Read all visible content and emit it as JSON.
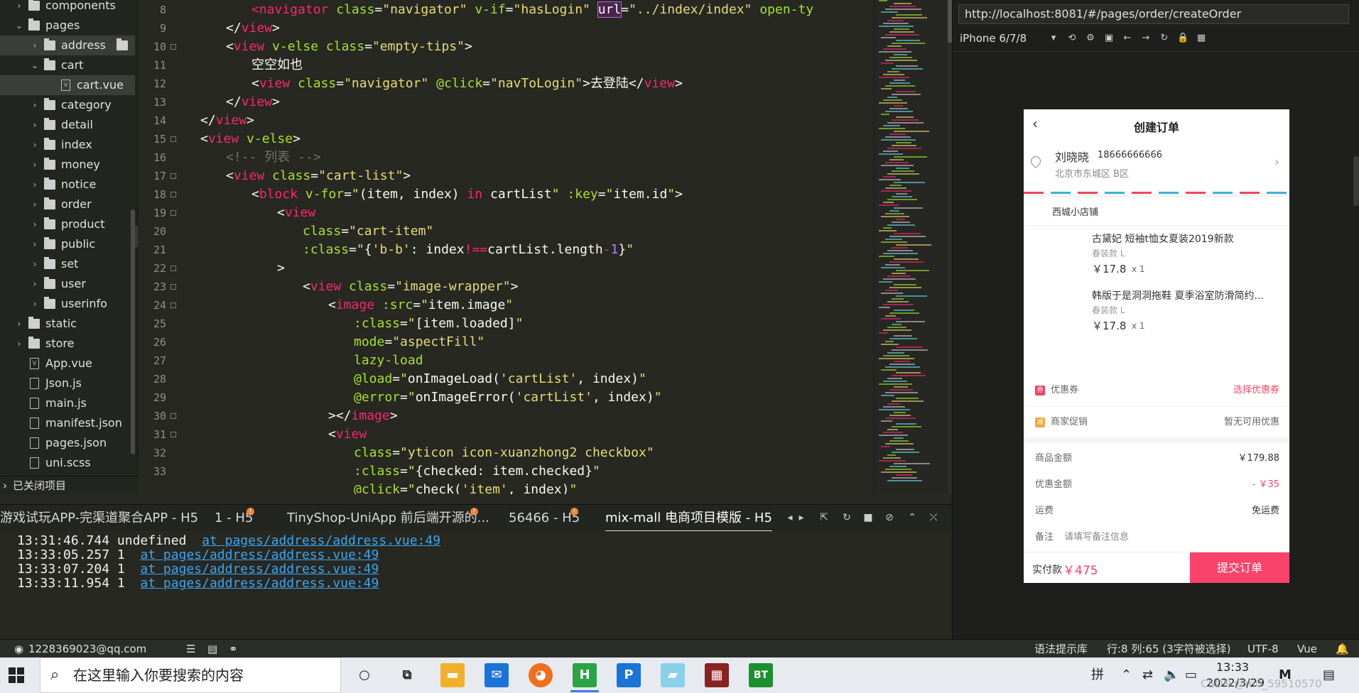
{
  "sidebar": {
    "items": [
      {
        "label": "components",
        "type": "folder",
        "open": false,
        "depth": 1
      },
      {
        "label": "pages",
        "type": "folder",
        "open": true,
        "depth": 1
      },
      {
        "label": "address",
        "type": "folder",
        "open": false,
        "depth": 2
      },
      {
        "label": "cart",
        "type": "folder",
        "open": true,
        "depth": 2
      },
      {
        "label": "cart.vue",
        "type": "file",
        "depth": 3
      },
      {
        "label": "category",
        "type": "folder",
        "open": false,
        "depth": 2
      },
      {
        "label": "detail",
        "type": "folder",
        "open": false,
        "depth": 2
      },
      {
        "label": "index",
        "type": "folder",
        "open": false,
        "depth": 2
      },
      {
        "label": "money",
        "type": "folder",
        "open": false,
        "depth": 2
      },
      {
        "label": "notice",
        "type": "folder",
        "open": false,
        "depth": 2
      },
      {
        "label": "order",
        "type": "folder",
        "open": false,
        "depth": 2
      },
      {
        "label": "product",
        "type": "folder",
        "open": false,
        "depth": 2
      },
      {
        "label": "public",
        "type": "folder",
        "open": false,
        "depth": 2
      },
      {
        "label": "set",
        "type": "folder",
        "open": false,
        "depth": 2
      },
      {
        "label": "user",
        "type": "folder",
        "open": false,
        "depth": 2
      },
      {
        "label": "userinfo",
        "type": "folder",
        "open": false,
        "depth": 2
      },
      {
        "label": "static",
        "type": "folder",
        "open": false,
        "depth": 1
      },
      {
        "label": "store",
        "type": "folder",
        "open": false,
        "depth": 1
      },
      {
        "label": "App.vue",
        "type": "file",
        "depth": 1
      },
      {
        "label": "Json.js",
        "type": "file",
        "depth": 1
      },
      {
        "label": "main.js",
        "type": "file",
        "depth": 1
      },
      {
        "label": "manifest.json",
        "type": "file",
        "depth": 1
      },
      {
        "label": "pages.json",
        "type": "file",
        "depth": 1
      },
      {
        "label": "uni.scss",
        "type": "file",
        "depth": 1
      }
    ],
    "closed_projects": "已关闭项目"
  },
  "editor": {
    "line_numbers": [
      "8",
      "9",
      "10",
      "11",
      "12",
      "13",
      "14",
      "15",
      "16",
      "17",
      "18",
      "19",
      "20",
      "21",
      "22",
      "23",
      "24",
      "25",
      "26",
      "27",
      "28",
      "29",
      "30",
      "31",
      "32",
      "33"
    ],
    "fold_lines": [
      "10",
      "15",
      "17",
      "18",
      "19",
      "22",
      "23",
      "24",
      "30",
      "31"
    ]
  },
  "console": {
    "tabs": [
      {
        "label": "游戏试玩APP-完渠道聚合APP - H5",
        "badge": ""
      },
      {
        "label": "1 - H5",
        "badge": "!"
      },
      {
        "label": "TinyShop-UniApp 前后端开源的...",
        "badge": "!"
      },
      {
        "label": "56466 - H5",
        "badge": "!"
      },
      {
        "label": "mix-mall 电商项目模版 - H5",
        "badge": ""
      }
    ],
    "logs": [
      {
        "time": "13:31:46.744",
        "msg": "undefined",
        "link": "at pages/address/address.vue:49"
      },
      {
        "time": "13:33:05.257",
        "msg": "1",
        "link": "at pages/address/address.vue:49"
      },
      {
        "time": "13:33:07.204",
        "msg": "1",
        "link": "at pages/address/address.vue:49"
      },
      {
        "time": "13:33:11.954",
        "msg": "1",
        "link": "at pages/address/address.vue:49"
      }
    ]
  },
  "status": {
    "user": "1228369023@qq.com",
    "syntax_lib": "语法提示库",
    "position": "行:8  列:65 (3字符被选择)",
    "encoding": "UTF-8",
    "language": "Vue"
  },
  "browser": {
    "url": "http://localhost:8081/#/pages/order/createOrder",
    "device": "iPhone 6/7/8"
  },
  "phone": {
    "title": "创建订单",
    "name": "刘晓晓",
    "phone": "18666666666",
    "address": "北京市东城区 B区",
    "shop": "西城小店铺",
    "goods": [
      {
        "title": "古黛妃 短袖t恤女夏装2019新款",
        "spec": "春装款 L",
        "price": "￥17.8",
        "qty": "x 1"
      },
      {
        "title": "韩版于是洞洞拖鞋 夏季浴室防滑简约...",
        "spec": "春装款 L",
        "price": "￥17.8",
        "qty": "x 1"
      }
    ],
    "coupon_label": "优惠券",
    "coupon_value": "选择优惠券",
    "promo_label": "商家促销",
    "promo_value": "暂无可用优惠",
    "amount_label": "商品金额",
    "amount_value": "￥179.88",
    "discount_label": "优惠金额",
    "discount_value": "- ￥35",
    "shipping_label": "运费",
    "shipping_value": "免运费",
    "remark_label": "备注",
    "remark_placeholder": "请填写备注信息",
    "pay_label": "实付款",
    "pay_value": "￥475",
    "submit_label": "提交订单"
  },
  "taskbar": {
    "search_placeholder": "在这里输入你要搜索的内容",
    "ime": "拼",
    "time": "13:33",
    "date": "2022/3/29",
    "watermark": "CSDN @m0_59510570"
  }
}
